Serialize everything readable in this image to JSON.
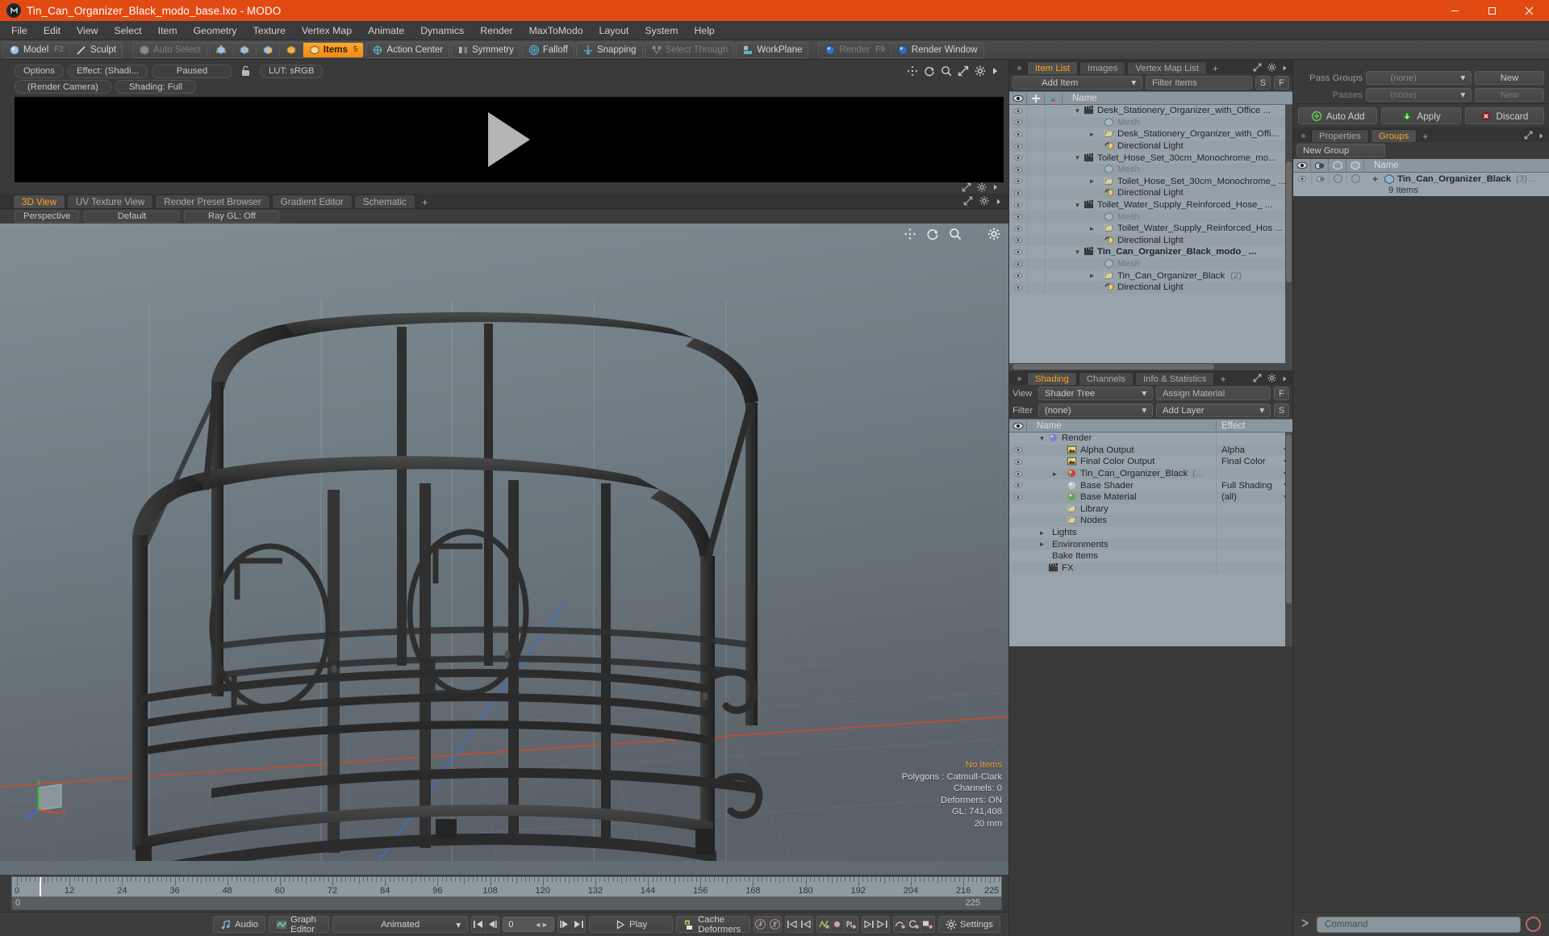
{
  "titlebar": {
    "title": "Tin_Can_Organizer_Black_modo_base.lxo - MODO",
    "minimize": "–",
    "maximize": "❐",
    "close": "✕"
  },
  "menubar": {
    "items": [
      "File",
      "Edit",
      "View",
      "Select",
      "Item",
      "Geometry",
      "Texture",
      "Vertex Map",
      "Animate",
      "Dynamics",
      "Render",
      "MaxToModo",
      "Layout",
      "System",
      "Help"
    ]
  },
  "toolbar": {
    "mode_model": "Model",
    "mode_model_hotkey": "F2",
    "mode_sculpt": "Sculpt",
    "auto_select": "Auto Select",
    "items": "Items",
    "items_hotkey": "5",
    "action_center": "Action Center",
    "symmetry": "Symmetry",
    "falloff": "Falloff",
    "snapping": "Snapping",
    "select_through": "Select Through",
    "workplane": "WorkPlane",
    "render": "Render",
    "render_hotkey": "F9",
    "render_window": "Render Window"
  },
  "render_preview": {
    "options": "Options",
    "effect": "Effect: (Shadi...",
    "paused": "Paused",
    "lut": "LUT: sRGB",
    "camera": "(Render Camera)",
    "shading": "Shading: Full"
  },
  "viewport": {
    "tabs": [
      {
        "label": "3D View",
        "active": true
      },
      {
        "label": "UV Texture View",
        "active": false
      },
      {
        "label": "Render Preset Browser",
        "active": false
      },
      {
        "label": "Gradient Editor",
        "active": false
      },
      {
        "label": "Schematic",
        "active": false
      }
    ],
    "tab_add": "+",
    "sub": {
      "perspective": "Perspective",
      "preset": "Default",
      "raygl": "Ray GL: Off"
    },
    "stats": {
      "no_items": "No Items",
      "polygons": "Polygons : Catmull-Clark",
      "channels": "Channels: 0",
      "deformers": "Deformers: ON",
      "gl": "GL: 741,408",
      "scale": "20 mm"
    },
    "axis": {
      "x": "X",
      "y": "Y",
      "z": "Z"
    }
  },
  "timeline": {
    "labels": [
      "0",
      "12",
      "24",
      "36",
      "48",
      "60",
      "72",
      "84",
      "96",
      "108",
      "120",
      "132",
      "144",
      "156",
      "168",
      "180",
      "192",
      "204",
      "216"
    ],
    "range_start": "0",
    "range_end": "225",
    "end_label": "225",
    "playhead": "0"
  },
  "bottombar": {
    "audio": "Audio",
    "graph_editor": "Graph Editor",
    "animated": "Animated",
    "frame_value": "0",
    "play": "Play",
    "cache_deformers": "Cache Deformers",
    "settings": "Settings"
  },
  "item_list": {
    "tabs": [
      {
        "label": "Item List",
        "active": true
      },
      {
        "label": "Images",
        "active": false
      },
      {
        "label": "Vertex Map List",
        "active": false
      }
    ],
    "tab_add": "+",
    "add_item": "Add Item",
    "filter_placeholder": "Filter Items",
    "btn_s": "S",
    "btn_f": "F",
    "col_name": "Name",
    "rows": [
      {
        "depth": 0,
        "caret": "down",
        "icon": "clapper",
        "label": "Desk_Stationery_Organizer_with_Office ...",
        "eye": true,
        "bold": false,
        "suffix": ""
      },
      {
        "depth": 1,
        "caret": "none",
        "icon": "mesh",
        "label": "Mesh",
        "eye": true,
        "dim": true,
        "suffix": ""
      },
      {
        "depth": 1,
        "caret": "right",
        "icon": "folder",
        "label": "Desk_Stationery_Organizer_with_Offi...",
        "eye": true,
        "suffix": ""
      },
      {
        "depth": 1,
        "caret": "none",
        "icon": "light",
        "label": "Directional Light",
        "eye": true,
        "suffix": ""
      },
      {
        "depth": 0,
        "caret": "down",
        "icon": "clapper",
        "label": "Toilet_Hose_Set_30cm_Monochrome_mo...",
        "eye": true,
        "suffix": ""
      },
      {
        "depth": 1,
        "caret": "none",
        "icon": "mesh",
        "label": "Mesh",
        "eye": true,
        "dim": true,
        "suffix": ""
      },
      {
        "depth": 1,
        "caret": "right",
        "icon": "folder",
        "label": "Toilet_Hose_Set_30cm_Monochrome_ ...",
        "eye": true,
        "suffix": ""
      },
      {
        "depth": 1,
        "caret": "none",
        "icon": "light",
        "label": "Directional Light",
        "eye": true,
        "suffix": ""
      },
      {
        "depth": 0,
        "caret": "down",
        "icon": "clapper",
        "label": "Toilet_Water_Supply_Reinforced_Hose_ ...",
        "eye": true,
        "suffix": ""
      },
      {
        "depth": 1,
        "caret": "none",
        "icon": "mesh",
        "label": "Mesh",
        "eye": true,
        "dim": true,
        "suffix": ""
      },
      {
        "depth": 1,
        "caret": "right",
        "icon": "folder",
        "label": "Toilet_Water_Supply_Reinforced_Hos ...",
        "eye": true,
        "suffix": ""
      },
      {
        "depth": 1,
        "caret": "none",
        "icon": "light",
        "label": "Directional Light",
        "eye": true,
        "suffix": ""
      },
      {
        "depth": 0,
        "caret": "down",
        "icon": "clapper",
        "label": "Tin_Can_Organizer_Black_modo_ ...",
        "eye": true,
        "bold": true,
        "suffix": ""
      },
      {
        "depth": 1,
        "caret": "none",
        "icon": "mesh",
        "label": "Mesh",
        "eye": true,
        "dim": true,
        "suffix": ""
      },
      {
        "depth": 1,
        "caret": "right",
        "icon": "folder",
        "label": "Tin_Can_Organizer_Black",
        "eye": true,
        "suffix": "(2)"
      },
      {
        "depth": 1,
        "caret": "none",
        "icon": "light",
        "label": "Directional Light",
        "eye": true,
        "suffix": ""
      }
    ]
  },
  "shading": {
    "tabs": [
      {
        "label": "Shading",
        "active": true
      },
      {
        "label": "Channels",
        "active": false
      },
      {
        "label": "Info & Statistics",
        "active": false
      }
    ],
    "tab_add": "+",
    "view_label": "View",
    "view_value": "Shader Tree",
    "assign_material": "Assign Material",
    "btn_f": "F",
    "filter_label": "Filter",
    "filter_value": "(none)",
    "add_layer": "Add Layer",
    "btn_s": "S",
    "col_name": "Name",
    "col_effect": "Effect",
    "rows": [
      {
        "depth": 0,
        "caret": "down",
        "icon": "sphere-blue",
        "label": "Render",
        "effect": "",
        "eye": false,
        "arrow": false
      },
      {
        "depth": 1,
        "caret": "none",
        "icon": "image",
        "label": "Alpha Output",
        "effect": "Alpha",
        "eye": true,
        "arrow": true
      },
      {
        "depth": 1,
        "caret": "none",
        "icon": "image",
        "label": "Final Color Output",
        "effect": "Final Color",
        "eye": true,
        "arrow": true
      },
      {
        "depth": 1,
        "caret": "right",
        "icon": "sphere-red",
        "label": "Tin_Can_Organizer_Black",
        "suffix": "(...",
        "effect": "",
        "eye": true,
        "arrow": true
      },
      {
        "depth": 1,
        "caret": "none",
        "icon": "sphere-white",
        "label": "Base Shader",
        "effect": "Full Shading",
        "eye": true,
        "arrow": true
      },
      {
        "depth": 1,
        "caret": "none",
        "icon": "sphere-green",
        "label": "Base Material",
        "effect": "(all)",
        "eye": true,
        "arrow": true
      },
      {
        "depth": 1,
        "caret": "none",
        "icon": "folder",
        "label": "Library",
        "effect": "",
        "eye": false,
        "arrow": false
      },
      {
        "depth": 1,
        "caret": "none",
        "icon": "folder",
        "label": "Nodes",
        "effect": "",
        "eye": false,
        "arrow": false
      },
      {
        "depth": 0,
        "caret": "right",
        "icon": "none",
        "label": "Lights",
        "effect": "",
        "eye": false,
        "arrow": false
      },
      {
        "depth": 0,
        "caret": "right",
        "icon": "none",
        "label": "Environments",
        "effect": "",
        "eye": false,
        "arrow": false
      },
      {
        "depth": 0,
        "caret": "none",
        "icon": "none",
        "label": "Bake Items",
        "effect": "",
        "eye": false,
        "arrow": false
      },
      {
        "depth": 0,
        "caret": "none",
        "icon": "clapper",
        "label": "FX",
        "effect": "",
        "eye": false,
        "arrow": false
      }
    ]
  },
  "passes": {
    "pass_groups_label": "Pass Groups",
    "pass_groups_value": "(none)",
    "pass_groups_new": "New",
    "passes_label": "Passes",
    "passes_value": "(none)",
    "passes_new": "New",
    "auto_add": "Auto Add",
    "apply": "Apply",
    "discard": "Discard"
  },
  "groups": {
    "tabs": [
      {
        "label": "Properties",
        "active": false
      },
      {
        "label": "Groups",
        "active": true
      }
    ],
    "tab_add": "+",
    "new_group": "New Group",
    "col_name": "Name",
    "row_label": "Tin_Can_Organizer_Black",
    "row_suffix": "(3)...",
    "row_sub": "9 Items",
    "expand": "+"
  },
  "command": {
    "placeholder": "Command"
  },
  "colors": {
    "title_bar": "#e24a13",
    "accent_tab": "#ffa322",
    "panel_bg": "#3a3a3a",
    "tree_bg": "#99a3ac",
    "viewport_top": "#7e8c92",
    "axis_x": "#d94b2b",
    "axis_y": "#3cc43c",
    "axis_z": "#3a6ce0",
    "model": "#2c2c2c"
  }
}
